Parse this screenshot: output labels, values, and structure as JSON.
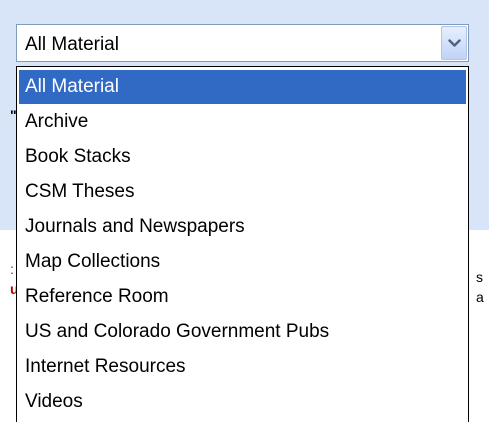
{
  "dropdown": {
    "selected_value": "All Material",
    "options": [
      {
        "label": "All Material",
        "selected": true
      },
      {
        "label": "Archive",
        "selected": false
      },
      {
        "label": "Book Stacks",
        "selected": false
      },
      {
        "label": "CSM Theses",
        "selected": false
      },
      {
        "label": "Journals and Newspapers",
        "selected": false
      },
      {
        "label": "Map Collections",
        "selected": false
      },
      {
        "label": "Reference Room",
        "selected": false
      },
      {
        "label": "US and Colorado Government Pubs",
        "selected": false
      },
      {
        "label": "Internet Resources",
        "selected": false
      },
      {
        "label": "Videos",
        "selected": false
      }
    ]
  },
  "background_fragments": {
    "left_1": "\"",
    "left_2": ":",
    "left_3": "u",
    "right_1": "s",
    "right_2": "a"
  },
  "colors": {
    "highlight": "#316ac5",
    "highlight_text": "#ffffff",
    "page_band": "#d8e4f8",
    "select_border": "#7f9db9",
    "list_border": "#000000"
  },
  "icons": {
    "dropdown_arrow": "chevron-down-icon"
  }
}
